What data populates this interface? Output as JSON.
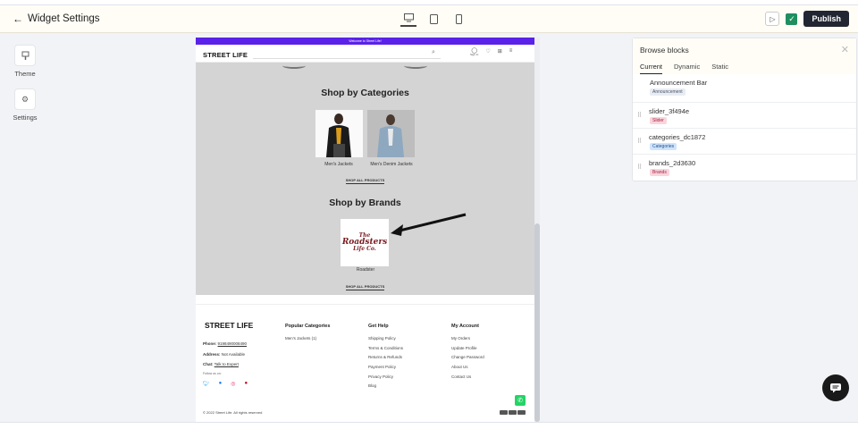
{
  "header": {
    "back_arrow": "←",
    "title": "Widget Settings",
    "publish_label": "Publish"
  },
  "leftnav": [
    {
      "label": "Theme"
    },
    {
      "label": "Settings"
    }
  ],
  "preview": {
    "announcement": "Welcome to Street Life!",
    "logo": "STREET LIFE",
    "signin": "Sign In",
    "categories_title": "Shop by Categories",
    "categories": [
      {
        "caption": "Men's Jackets"
      },
      {
        "caption": "Men's Denim Jackets"
      }
    ],
    "shop_all_1": "SHOP ALL PRODUCTS",
    "brands_title": "Shop by Brands",
    "brand_logo_text_1": "The",
    "brand_logo_text_2": "Roadsters",
    "brand_logo_text_3": "Life Co.",
    "brand_caption": "Roadster",
    "shop_all_2": "SHOP ALL PRODUCTS"
  },
  "footer": {
    "logo": "STREET LIFE",
    "phone_label": "Phone:",
    "phone_value": "9198490008490",
    "address_label": "Address:",
    "address_value": "Not Available",
    "chat_label": "Chat:",
    "chat_value": "Talk to Expert",
    "follow": "Follow us on:",
    "cols": [
      {
        "title": "Popular Categories",
        "links": [
          "Men's Jackets (1)"
        ]
      },
      {
        "title": "Get Help",
        "links": [
          "Shipping Policy",
          "Terms & Conditions",
          "Returns & Refunds",
          "Payment Policy",
          "Privacy Policy",
          "Blog"
        ]
      },
      {
        "title": "My Account",
        "links": [
          "My Orders",
          "Update Profile",
          "Change Password",
          "About Us",
          "Contact Us"
        ]
      }
    ],
    "copyright": "© 2022 Street Life. All rights reserved"
  },
  "panel": {
    "title": "Browse blocks",
    "tabs": [
      "Current",
      "Dynamic",
      "Static"
    ],
    "blocks": [
      {
        "name": "Announcement Bar",
        "tag": "Announcement",
        "tag_bg": "#e8ecf3",
        "tag_fg": "#4a5568"
      },
      {
        "name": "slider_3f494e",
        "tag": "Slider",
        "tag_bg": "#fad4dc",
        "tag_fg": "#a3243f"
      },
      {
        "name": "categories_dc1872",
        "tag": "Categories",
        "tag_bg": "#cfe3fb",
        "tag_fg": "#23518f"
      },
      {
        "name": "brands_2d3630",
        "tag": "Brands",
        "tag_bg": "#fad4dc",
        "tag_fg": "#a3243f"
      }
    ]
  },
  "colors": {
    "announcement_bar": "#5b21e8",
    "publish": "#222532",
    "check": "#1f8f5f"
  }
}
